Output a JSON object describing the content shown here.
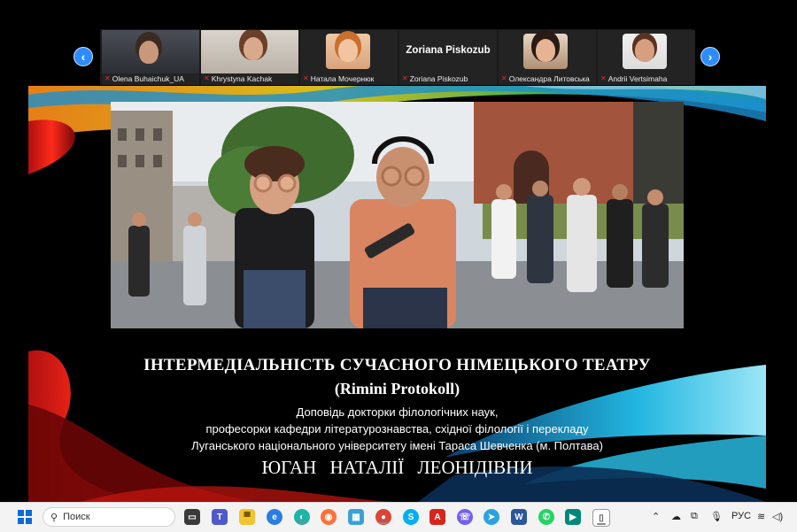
{
  "participants": {
    "prev_icon": "chevron-left-icon",
    "next_icon": "chevron-right-icon",
    "items": [
      {
        "name": "Olena Buhaichuk_UA",
        "muted": true
      },
      {
        "name": "Khrystyna Kachak",
        "muted": true
      },
      {
        "name": "Натала Мочернюк",
        "muted": true
      },
      {
        "name": "Zoriana Piskozub",
        "muted": true,
        "big_name": "Zoriana Piskozub"
      },
      {
        "name": "Олександра Литовська",
        "muted": true
      },
      {
        "name": "Andrii Vertsimaha",
        "muted": true
      }
    ]
  },
  "slide": {
    "title_line1": "ІНТЕРМЕДІАЛЬНІСТЬ СУЧАСНОГО НІМЕЦЬКОГО ТЕАТРУ",
    "title_line2": "(Rimini Protokoll)",
    "subtitle_line1": "Доповідь докторки філологічних наук,",
    "subtitle_line2": "професорки кафедри літературознавства, східної філології і перекладу",
    "subtitle_line3": "Луганського національного університету імені Тараса Шевченка (м. Полтава)",
    "author": "ЮГАН НАТАЛІЇ ЛЕОНІДІВНИ"
  },
  "taskbar": {
    "search_placeholder": "Поиск",
    "language": "РУС",
    "icons": [
      "windows-start-icon",
      "task-view-icon",
      "teams-icon",
      "file-explorer-icon",
      "edge-icon",
      "firefox-icon",
      "store-icon",
      "chrome-icon",
      "skype-icon",
      "pdf-icon",
      "viber-icon",
      "telegram-icon",
      "word-icon",
      "whatsapp-icon",
      "meet-icon",
      "document-icon"
    ]
  },
  "colors": {
    "accent": "#2d8cff",
    "slide_red": "#e0201c",
    "slide_cyan": "#25b8d8",
    "mute_red": "#e02b2b"
  }
}
